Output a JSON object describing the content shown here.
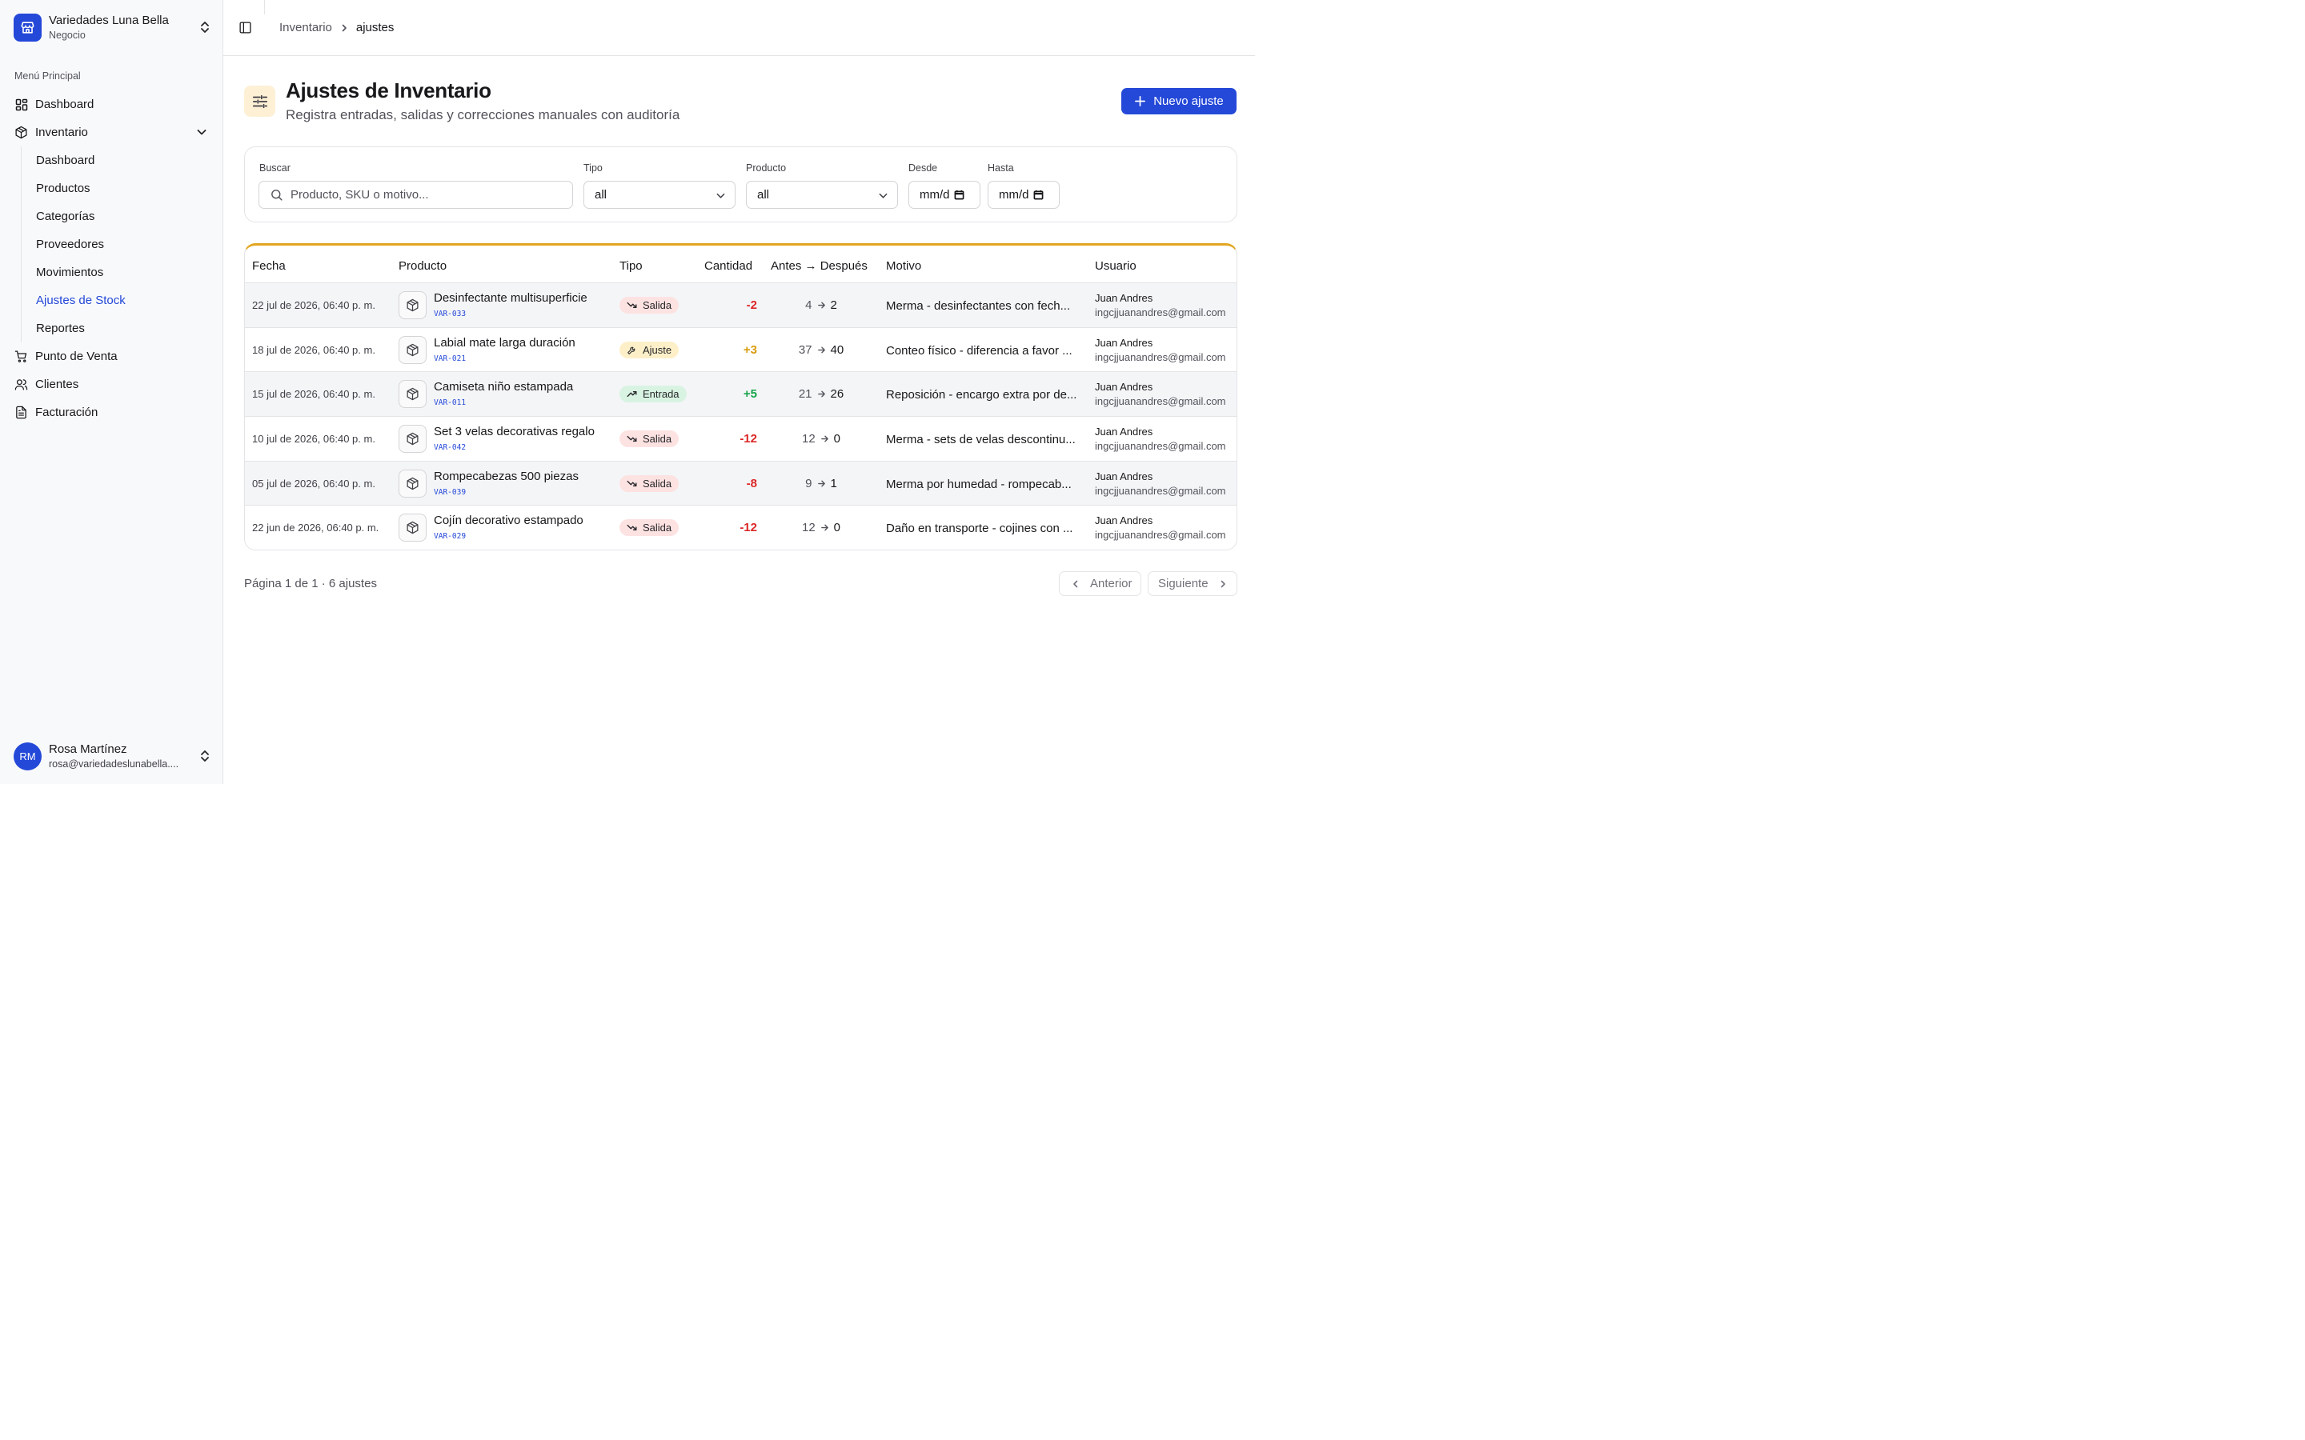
{
  "workspace": {
    "name": "Variedades Luna Bella",
    "subtitle": "Negocio"
  },
  "sidebar": {
    "group_label": "Menú Principal",
    "items": [
      {
        "label": "Dashboard",
        "icon": "dashboard-icon"
      },
      {
        "label": "Inventario",
        "icon": "box-icon",
        "expanded": true,
        "children": [
          {
            "label": "Dashboard"
          },
          {
            "label": "Productos"
          },
          {
            "label": "Categorías"
          },
          {
            "label": "Proveedores"
          },
          {
            "label": "Movimientos"
          },
          {
            "label": "Ajustes de Stock",
            "active": true
          },
          {
            "label": "Reportes"
          }
        ]
      },
      {
        "label": "Punto de Venta",
        "icon": "cart-icon"
      },
      {
        "label": "Clientes",
        "icon": "users-icon"
      },
      {
        "label": "Facturación",
        "icon": "file-icon"
      }
    ]
  },
  "user": {
    "initials": "RM",
    "name": "Rosa Martínez",
    "email": "rosa@variedadeslunabella...."
  },
  "breadcrumb": {
    "parent": "Inventario",
    "current": "ajustes"
  },
  "page": {
    "title": "Ajustes de Inventario",
    "subtitle": "Registra entradas, salidas y correcciones manuales con auditoría",
    "new_button": "Nuevo ajuste"
  },
  "filters": {
    "search_label": "Buscar",
    "search_placeholder": "Producto, SKU o motivo...",
    "tipo_label": "Tipo",
    "tipo_value": "all",
    "producto_label": "Producto",
    "producto_value": "all",
    "desde_label": "Desde",
    "desde_value": "mm/d",
    "hasta_label": "Hasta",
    "hasta_value": "mm/d"
  },
  "table": {
    "headers": {
      "fecha": "Fecha",
      "producto": "Producto",
      "tipo": "Tipo",
      "cantidad": "Cantidad",
      "antes_despues": "Antes → Después",
      "motivo": "Motivo",
      "usuario": "Usuario"
    },
    "rows": [
      {
        "date": "22 jul de 2026, 06:40 p. m.",
        "product": "Desinfectante multisuperficie",
        "sku": "VAR-033",
        "type": "Salida",
        "kind": "salida",
        "qty": "-2",
        "before": "4",
        "after": "2",
        "reason": "Merma - desinfectantes con fech...",
        "user": "Juan Andres",
        "email": "ingcjjuanandres@gmail.com"
      },
      {
        "date": "18 jul de 2026, 06:40 p. m.",
        "product": "Labial mate larga duración",
        "sku": "VAR-021",
        "type": "Ajuste",
        "kind": "ajuste",
        "qty": "+3",
        "before": "37",
        "after": "40",
        "reason": "Conteo físico - diferencia a favor ...",
        "user": "Juan Andres",
        "email": "ingcjjuanandres@gmail.com"
      },
      {
        "date": "15 jul de 2026, 06:40 p. m.",
        "product": "Camiseta niño estampada",
        "sku": "VAR-011",
        "type": "Entrada",
        "kind": "entrada",
        "qty": "+5",
        "before": "21",
        "after": "26",
        "reason": "Reposición - encargo extra por de...",
        "user": "Juan Andres",
        "email": "ingcjjuanandres@gmail.com"
      },
      {
        "date": "10 jul de 2026, 06:40 p. m.",
        "product": "Set 3 velas decorativas regalo",
        "sku": "VAR-042",
        "type": "Salida",
        "kind": "salida",
        "qty": "-12",
        "before": "12",
        "after": "0",
        "reason": "Merma - sets de velas descontinu...",
        "user": "Juan Andres",
        "email": "ingcjjuanandres@gmail.com"
      },
      {
        "date": "05 jul de 2026, 06:40 p. m.",
        "product": "Rompecabezas 500 piezas",
        "sku": "VAR-039",
        "type": "Salida",
        "kind": "salida",
        "qty": "-8",
        "before": "9",
        "after": "1",
        "reason": "Merma por humedad - rompecab...",
        "user": "Juan Andres",
        "email": "ingcjjuanandres@gmail.com"
      },
      {
        "date": "22 jun de 2026, 06:40 p. m.",
        "product": "Cojín decorativo estampado",
        "sku": "VAR-029",
        "type": "Salida",
        "kind": "salida",
        "qty": "-12",
        "before": "12",
        "after": "0",
        "reason": "Daño en transporte - cojines con ...",
        "user": "Juan Andres",
        "email": "ingcjjuanandres@gmail.com"
      }
    ]
  },
  "pagination": {
    "info": "Página 1 de 1 · 6 ajustes",
    "prev": "Anterior",
    "next": "Siguiente"
  },
  "colors": {
    "accent": "#2448d8",
    "table_top_border": "#e2a61f",
    "negative": "#dc2626",
    "positive": "#16a34a",
    "adjust": "#d99b0b"
  }
}
